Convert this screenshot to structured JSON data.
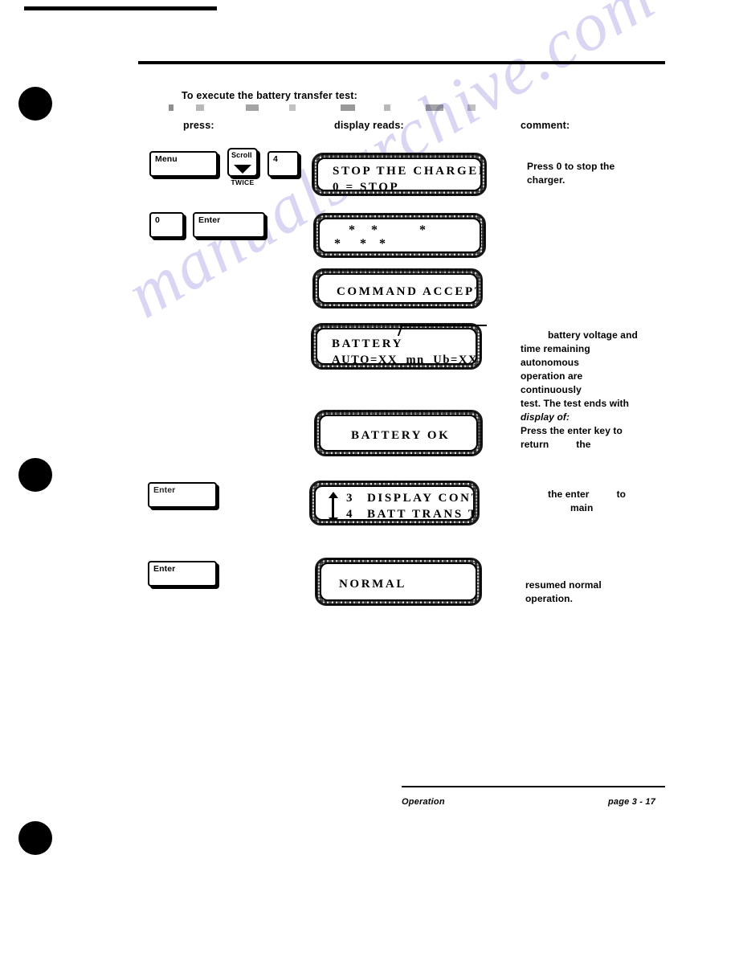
{
  "document": {
    "intro": "To execute the battery transfer test:",
    "columns": {
      "press": "press:",
      "display": "display reads:",
      "comment": "comment:"
    },
    "footer": {
      "section": "Operation",
      "page": "page 3 - 17"
    },
    "watermark": "manualsarchive.com"
  },
  "keys": {
    "menu": "Menu",
    "scroll": "Scroll",
    "scroll_note": "TWICE",
    "four": "4",
    "zero": "0",
    "enter1": "Enter",
    "enter2": "Enter",
    "enter3": "Enter"
  },
  "displays": {
    "stop_charger": {
      "line1": "STOP THE CHARGER",
      "line2": "0 = STOP  __"
    },
    "stars": {
      "line1": "*     *             *",
      "line2": "*      *    *"
    },
    "command_accepted": {
      "line1": "COMMAND ACCEPTED"
    },
    "battery": {
      "line1": "BATTERY",
      "line2": "AUTO=XX  mn  Ub=XXX V"
    },
    "battery_ok": {
      "line1": "BATTERY OK"
    },
    "menu_list": {
      "line1_num": "3",
      "line1_text": "DISPLAY CONTRAST",
      "line2_num": "4",
      "line2_text": "BATT TRANS TEST"
    },
    "normal": {
      "line1": "NORMAL"
    }
  },
  "comments": {
    "c1_line1": "Press 0 to stop the",
    "c1_line2": "charger.",
    "c2_line1": "battery voltage and",
    "c2_line2": "time remaining",
    "c2_line3": "autonomous",
    "c2_line4": "operation are",
    "c2_line5": "continuously",
    "c2_line6": "test. The test ends with",
    "c2_line7": "display of:",
    "c2_line8": "Press the enter key to",
    "c2_line9": "return",
    "c2_line9b": "the",
    "c3_line1a": "the enter",
    "c3_line1b": "to",
    "c3_line2": "main",
    "c4_line1": "resumed normal",
    "c4_line2": "operation."
  }
}
